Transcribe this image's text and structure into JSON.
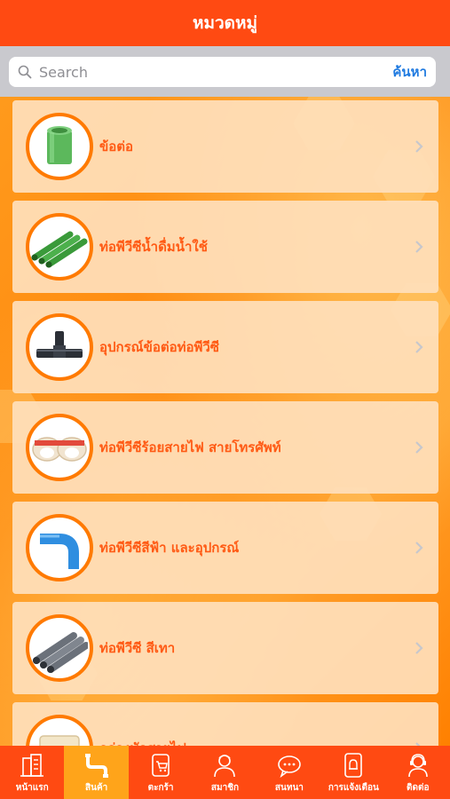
{
  "header": {
    "title": "หมวดหมู่"
  },
  "search": {
    "placeholder": "Search",
    "button_label": "ค้นหา"
  },
  "categories": [
    {
      "label": "ข้อต่อ",
      "icon": "pvc-coupling-icon"
    },
    {
      "label": "ท่อพีวีซีน้ำดื่มน้ำใช้",
      "icon": "green-pipes-icon"
    },
    {
      "label": "อุปกรณ์ข้อต่อท่อพีวีซี",
      "icon": "tee-fitting-icon"
    },
    {
      "label": "ท่อพีวีซีร้อยสายไฟ สายโทรศัพท์",
      "icon": "conduit-boxes-icon"
    },
    {
      "label": "ท่อพีวีซีสีฟ้า และอุปกรณ์",
      "icon": "blue-elbow-icon"
    },
    {
      "label": "ท่อพีวีซี สีเทา",
      "icon": "grey-pipes-icon"
    },
    {
      "label": "กล่องพักสายไฟ",
      "icon": "junction-box-icon"
    }
  ],
  "tabs": [
    {
      "label": "หน้าแรก",
      "icon": "home-building-icon",
      "active": false
    },
    {
      "label": "สินค้า",
      "icon": "pipe-product-icon",
      "active": true
    },
    {
      "label": "ตะกร้า",
      "icon": "cart-icon",
      "active": false
    },
    {
      "label": "สมาชิก",
      "icon": "member-icon",
      "active": false
    },
    {
      "label": "สนทนา",
      "icon": "chat-icon",
      "active": false
    },
    {
      "label": "การแจ้งเตือน",
      "icon": "notification-icon",
      "active": false
    },
    {
      "label": "ติดต่อ",
      "icon": "contact-icon",
      "active": false
    }
  ],
  "colors": {
    "header": "#ff4a12",
    "label": "#ff5a14",
    "card": "#ffe0bc",
    "tab_active": "#ffa41a",
    "search_button": "#1f7ae0"
  }
}
